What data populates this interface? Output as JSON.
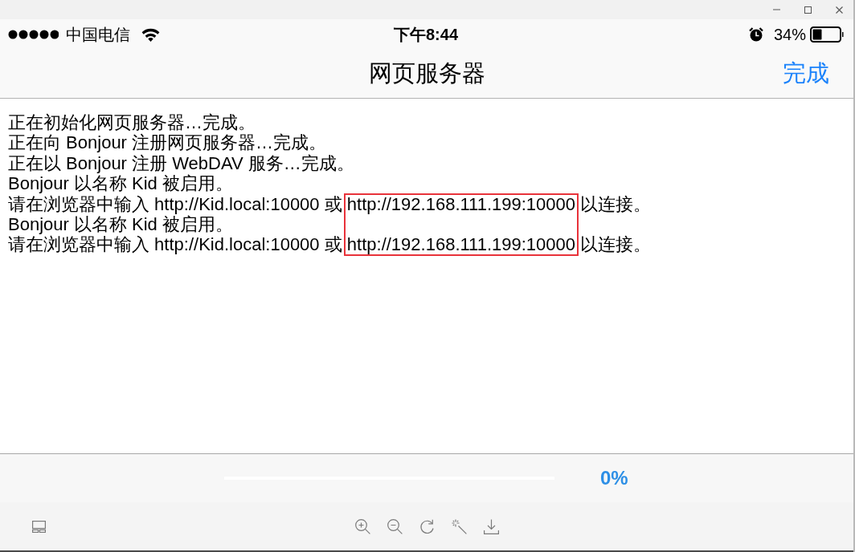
{
  "status_bar": {
    "carrier": "中国电信",
    "time": "下午8:44",
    "battery": "34%"
  },
  "nav_bar": {
    "title": "网页服务器",
    "done_button": "完成"
  },
  "log": {
    "lines": [
      {
        "parts": [
          {
            "text": "正在初始化网页服务器…完成。",
            "highlighted": false
          }
        ]
      },
      {
        "parts": [
          {
            "text": "正在向 Bonjour 注册网页服务器…完成。",
            "highlighted": false
          }
        ]
      },
      {
        "parts": [
          {
            "text": "正在以 Bonjour 注册 WebDAV 服务…完成。",
            "highlighted": false
          }
        ]
      },
      {
        "parts": [
          {
            "text": "Bonjour 以名称 Kid 被启用。",
            "highlighted": false
          }
        ]
      },
      {
        "parts": [
          {
            "text": "请在浏览器中输入 http://Kid.local:10000 或 ",
            "highlighted": false
          },
          {
            "text": "http://192.168.111.199:10000",
            "highlighted": true
          },
          {
            "text": " 以连接。",
            "highlighted": false
          }
        ]
      },
      {
        "parts": [
          {
            "text": "Bonjour 以名称 Kid 被启用。",
            "highlighted": false
          }
        ]
      },
      {
        "parts": [
          {
            "text": "请在浏览器中输入 http://Kid.local:10000 或 ",
            "highlighted": false
          },
          {
            "text": "http://192.168.111.199:10000",
            "highlighted": true
          },
          {
            "text": " 以连接。",
            "highlighted": false
          }
        ]
      }
    ]
  },
  "progress": {
    "level": 0,
    "reading": "0%"
  }
}
